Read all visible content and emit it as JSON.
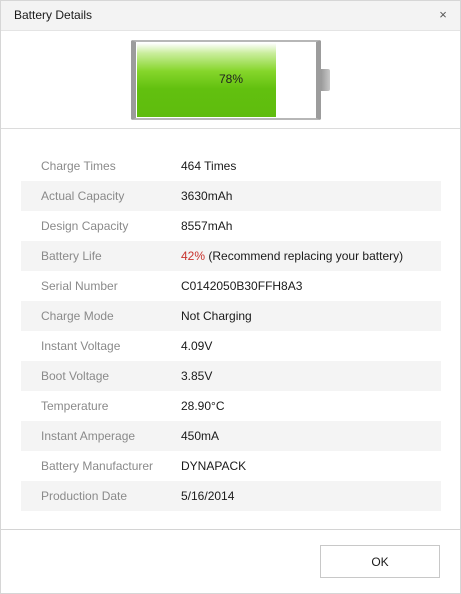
{
  "window": {
    "title": "Battery Details",
    "close_glyph": "×"
  },
  "battery": {
    "percent_text": "78%",
    "charge_fraction": 0.78,
    "fill_color": "#62c00f"
  },
  "details": [
    {
      "label": "Charge Times",
      "value": "464 Times"
    },
    {
      "label": "Actual Capacity",
      "value": "3630mAh"
    },
    {
      "label": "Design Capacity",
      "value": "8557mAh"
    },
    {
      "label": "Battery Life",
      "value": "42%",
      "note": " (Recommend replacing your battery)",
      "value_color": "#c8322d"
    },
    {
      "label": "Serial Number",
      "value": "C0142050B30FFH8A3"
    },
    {
      "label": "Charge Mode",
      "value": "Not Charging"
    },
    {
      "label": "Instant Voltage",
      "value": "4.09V"
    },
    {
      "label": "Boot Voltage",
      "value": "3.85V"
    },
    {
      "label": "Temperature",
      "value": "28.90°C"
    },
    {
      "label": "Instant Amperage",
      "value": "450mA"
    },
    {
      "label": "Battery Manufacturer",
      "value": "DYNAPACK"
    },
    {
      "label": "Production Date",
      "value": "5/16/2014"
    }
  ],
  "footer": {
    "ok_label": "OK"
  }
}
